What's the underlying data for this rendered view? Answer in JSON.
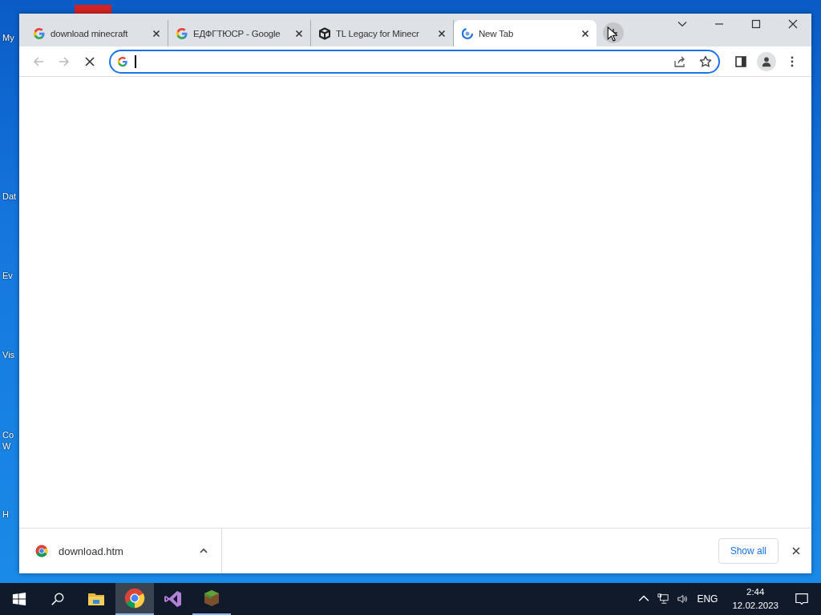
{
  "desktop_icons": [
    {
      "label": [
        "My"
      ]
    },
    {
      "label": [
        "Dat"
      ]
    },
    {
      "label": [
        "Ev"
      ]
    },
    {
      "label": [
        "Vis"
      ]
    },
    {
      "label": [
        "Co",
        "W"
      ]
    },
    {
      "label": [
        "H"
      ]
    }
  ],
  "browser": {
    "tabs": [
      {
        "title": "download minecraft",
        "kind": "google",
        "selected": false
      },
      {
        "title": "ЕДФГТЮСР - Google",
        "kind": "google",
        "selected": false
      },
      {
        "title": "TL Legacy for Minecr",
        "kind": "cube",
        "selected": false
      },
      {
        "title": "New Tab",
        "kind": "loading",
        "selected": true
      }
    ],
    "loading": true,
    "downloads": [
      {
        "name": "download.htm"
      }
    ],
    "show_all": "Show all"
  },
  "taskbar": {
    "apps": [
      {
        "kind": "folder",
        "running": false,
        "active": false
      },
      {
        "kind": "chrome",
        "running": true,
        "active": true
      },
      {
        "kind": "studio",
        "running": false,
        "active": false
      },
      {
        "kind": "grass",
        "running": true,
        "active": false
      }
    ],
    "language": "ENG",
    "time": "2:44",
    "date": "12.02.2023"
  }
}
